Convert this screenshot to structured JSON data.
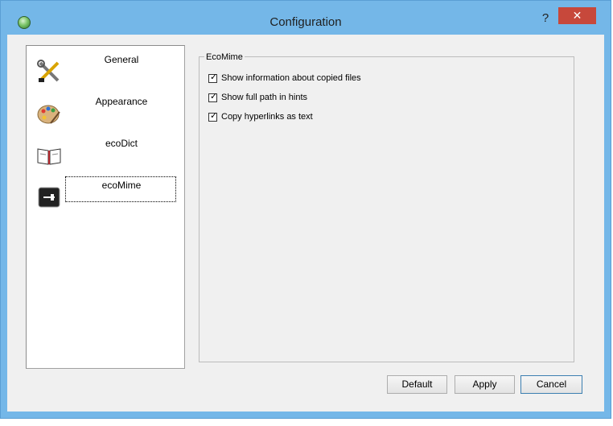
{
  "window": {
    "title": "Configuration",
    "help_label": "?",
    "close_label": "✕"
  },
  "sidebar": {
    "items": [
      {
        "label": "General",
        "icon": "tools-icon"
      },
      {
        "label": "Appearance",
        "icon": "palette-icon"
      },
      {
        "label": "ecoDict",
        "icon": "book-icon"
      },
      {
        "label": "ecoMime",
        "icon": "ecomime-icon",
        "selected": true
      }
    ]
  },
  "group": {
    "title": "EcoMime",
    "options": [
      {
        "label": "Show information about copied files",
        "checked": true
      },
      {
        "label": "Show full path in hints",
        "checked": true
      },
      {
        "label": "Copy hyperlinks as text",
        "checked": true
      }
    ]
  },
  "buttons": {
    "default_label": "Default",
    "apply_label": "Apply",
    "cancel_label": "Cancel"
  },
  "check_mark": "✓",
  "colors": {
    "titlebar": "#74b7e8",
    "close": "#c7483b",
    "client": "#f0f0f0"
  }
}
